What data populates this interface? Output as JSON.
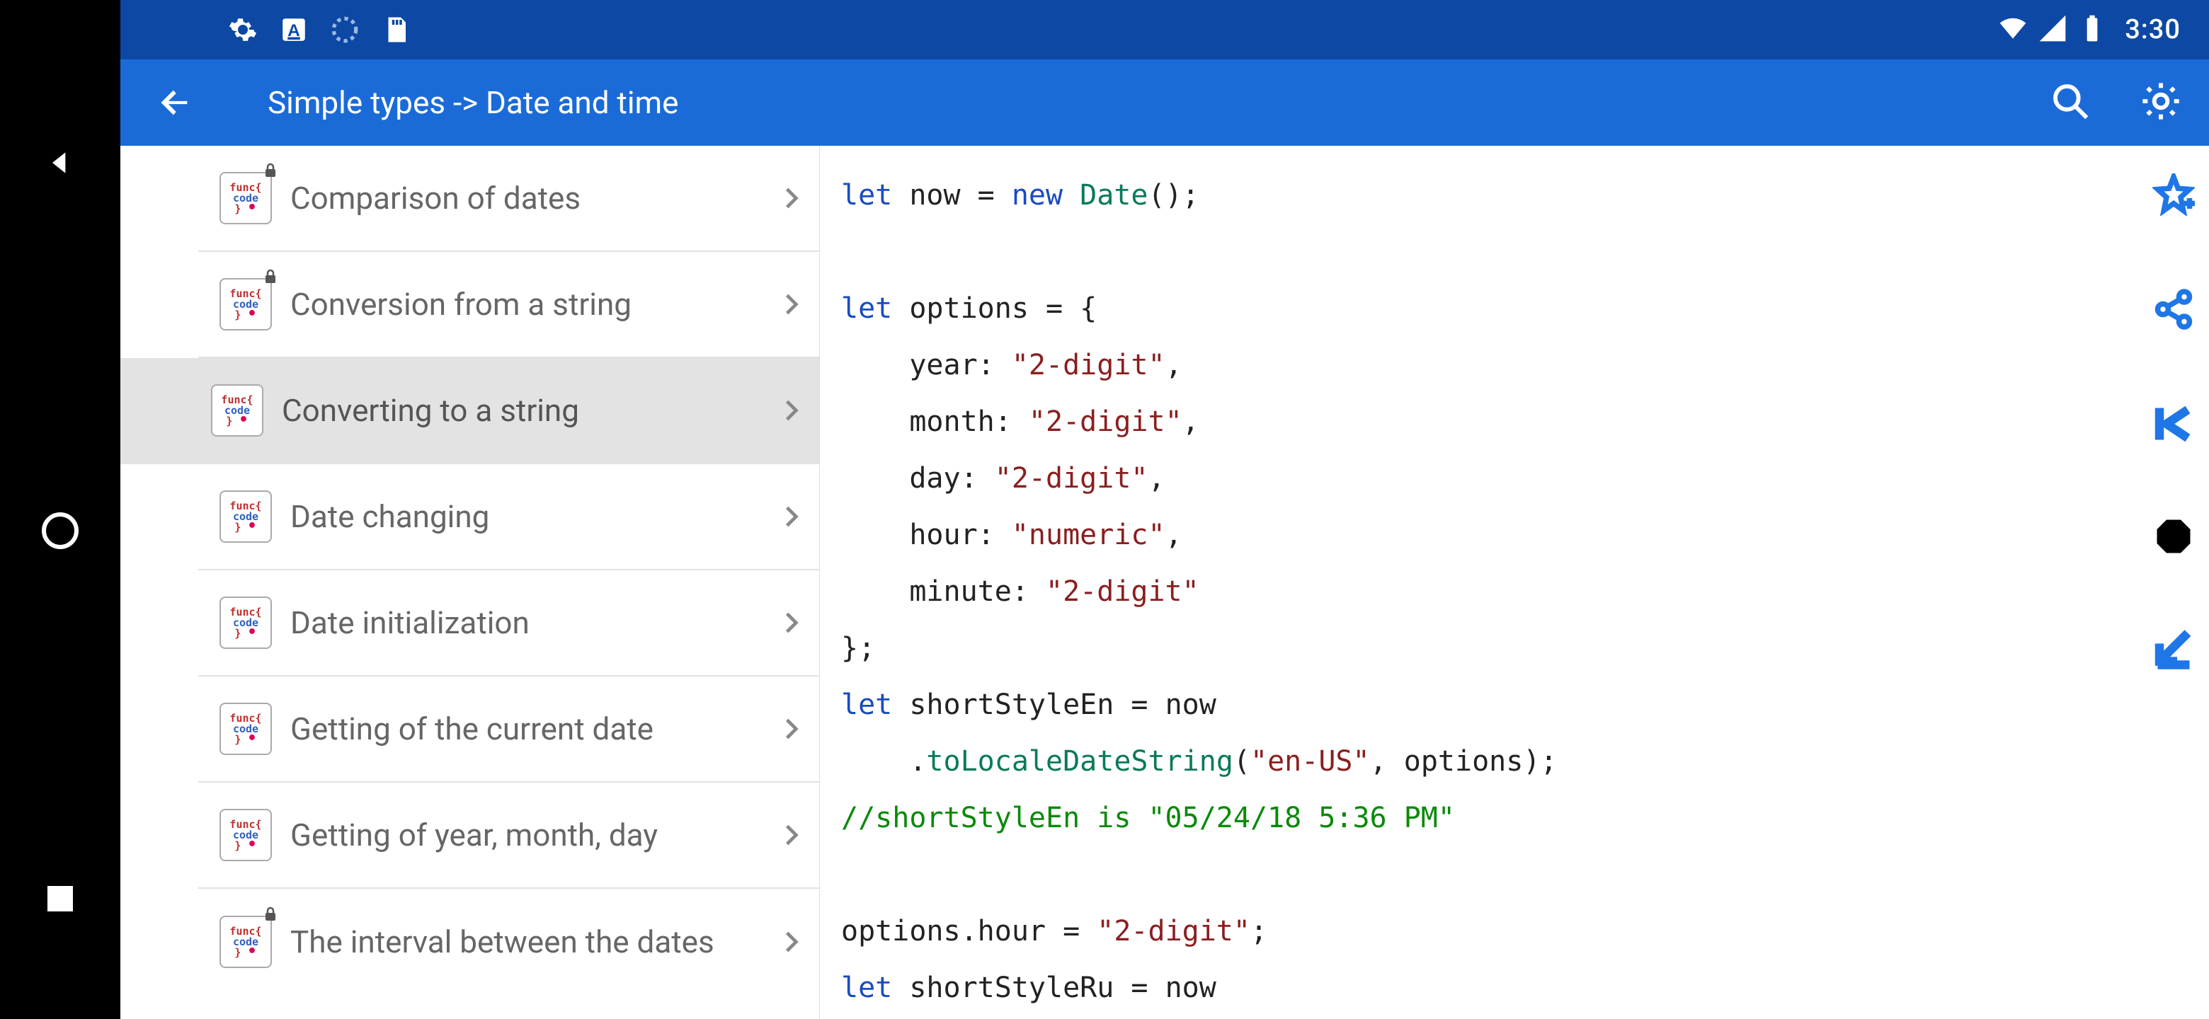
{
  "status": {
    "time": "3:30"
  },
  "appbar": {
    "title": "Simple types -> Date and time"
  },
  "sidebar": {
    "items": [
      {
        "label": "Comparison of dates",
        "locked": true,
        "selected": false
      },
      {
        "label": "Conversion from a string",
        "locked": true,
        "selected": false
      },
      {
        "label": "Converting to a string",
        "locked": false,
        "selected": true
      },
      {
        "label": "Date changing",
        "locked": false,
        "selected": false
      },
      {
        "label": "Date initialization",
        "locked": false,
        "selected": false
      },
      {
        "label": "Getting of the current date",
        "locked": false,
        "selected": false
      },
      {
        "label": "Getting of year, month, day",
        "locked": false,
        "selected": false
      },
      {
        "label": "The interval between the dates",
        "locked": true,
        "selected": false
      }
    ]
  },
  "code": {
    "lines": [
      {
        "t": [
          {
            "c": "kw",
            "s": "let"
          },
          {
            "c": "",
            "s": " now = "
          },
          {
            "c": "kn",
            "s": "new"
          },
          {
            "c": "",
            "s": " "
          },
          {
            "c": "cls",
            "s": "Date"
          },
          {
            "c": "",
            "s": "();"
          }
        ]
      },
      {
        "t": []
      },
      {
        "t": [
          {
            "c": "kw",
            "s": "let"
          },
          {
            "c": "",
            "s": " options = {"
          }
        ]
      },
      {
        "t": [
          {
            "c": "",
            "s": "    year: "
          },
          {
            "c": "str",
            "s": "\"2-digit\""
          },
          {
            "c": "",
            "s": ","
          }
        ]
      },
      {
        "t": [
          {
            "c": "",
            "s": "    month: "
          },
          {
            "c": "str",
            "s": "\"2-digit\""
          },
          {
            "c": "",
            "s": ","
          }
        ]
      },
      {
        "t": [
          {
            "c": "",
            "s": "    day: "
          },
          {
            "c": "str",
            "s": "\"2-digit\""
          },
          {
            "c": "",
            "s": ","
          }
        ]
      },
      {
        "t": [
          {
            "c": "",
            "s": "    hour: "
          },
          {
            "c": "str",
            "s": "\"numeric\""
          },
          {
            "c": "",
            "s": ","
          }
        ]
      },
      {
        "t": [
          {
            "c": "",
            "s": "    minute: "
          },
          {
            "c": "str",
            "s": "\"2-digit\""
          }
        ]
      },
      {
        "t": [
          {
            "c": "",
            "s": "};"
          }
        ]
      },
      {
        "t": [
          {
            "c": "kw",
            "s": "let"
          },
          {
            "c": "",
            "s": " shortStyleEn = now"
          }
        ]
      },
      {
        "t": [
          {
            "c": "",
            "s": "    ."
          },
          {
            "c": "fn",
            "s": "toLocaleDateString"
          },
          {
            "c": "",
            "s": "("
          },
          {
            "c": "str",
            "s": "\"en-US\""
          },
          {
            "c": "",
            "s": ", options);"
          }
        ]
      },
      {
        "t": [
          {
            "c": "cmt",
            "s": "//shortStyleEn is \"05/24/18 5:36 PM\""
          }
        ]
      },
      {
        "t": []
      },
      {
        "t": [
          {
            "c": "",
            "s": "options.hour = "
          },
          {
            "c": "str",
            "s": "\"2-digit\""
          },
          {
            "c": "",
            "s": ";"
          }
        ]
      },
      {
        "t": [
          {
            "c": "kw",
            "s": "let"
          },
          {
            "c": "",
            "s": " shortStyleRu = now"
          }
        ]
      }
    ]
  },
  "icons": {
    "star": "star-add-icon",
    "share": "share-icon",
    "komodo": "scroll-top-icon",
    "hex": "marker-icon",
    "down": "scroll-bottom-icon",
    "gear": "settings-icon",
    "aicon": "keyboard-icon",
    "fan": "sync-icon",
    "sd": "sd-card-icon"
  }
}
